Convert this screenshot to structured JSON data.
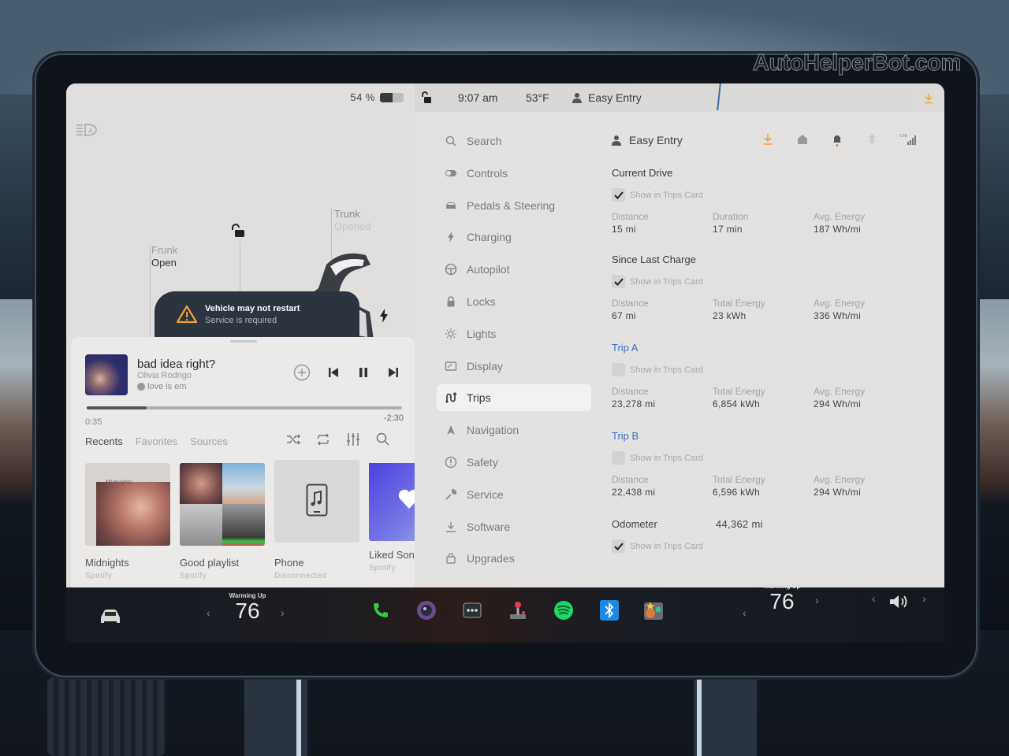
{
  "watermark": "AutoHelperBot.com",
  "status": {
    "battery_percent": "54 %",
    "battery_level": 0.54,
    "time": "9:07 am",
    "temperature": "53°F",
    "driver_profile": "Easy Entry"
  },
  "vehicle": {
    "frunk_label": "Frunk",
    "frunk_state": "Open",
    "trunk_label": "Trunk",
    "trunk_state": "Opened",
    "alert_title": "Vehicle may not restart",
    "alert_subtitle": "Service is required"
  },
  "media": {
    "track_title": "bad idea right?",
    "artist": "Olivia Rodrigo",
    "source": "love is em",
    "elapsed": "0:35",
    "remaining": "-2:30",
    "progress": 0.19,
    "tabs": [
      {
        "label": "Recents",
        "active": true
      },
      {
        "label": "Favorites",
        "active": false
      },
      {
        "label": "Sources",
        "active": false
      }
    ],
    "tiles": [
      {
        "name": "Midnights",
        "subtitle": "Spotify",
        "art_label": "Midnights"
      },
      {
        "name": "Good playlist",
        "subtitle": "Spotify"
      },
      {
        "name": "Phone",
        "subtitle": "Disconnected"
      },
      {
        "name": "Liked Songs",
        "subtitle": "Spotify"
      }
    ]
  },
  "menu": {
    "items": [
      {
        "label": "Search",
        "icon": "search-icon",
        "active": false
      },
      {
        "label": "Controls",
        "icon": "toggle-icon",
        "active": false
      },
      {
        "label": "Pedals & Steering",
        "icon": "car-front-icon",
        "active": false
      },
      {
        "label": "Charging",
        "icon": "bolt-icon",
        "active": false
      },
      {
        "label": "Autopilot",
        "icon": "steering-wheel-icon",
        "active": false
      },
      {
        "label": "Locks",
        "icon": "lock-icon",
        "active": false
      },
      {
        "label": "Lights",
        "icon": "sun-icon",
        "active": false
      },
      {
        "label": "Display",
        "icon": "display-icon",
        "active": false
      },
      {
        "label": "Trips",
        "icon": "route-icon",
        "active": true
      },
      {
        "label": "Navigation",
        "icon": "navigation-arrow-icon",
        "active": false
      },
      {
        "label": "Safety",
        "icon": "alert-circle-icon",
        "active": false
      },
      {
        "label": "Service",
        "icon": "wrench-icon",
        "active": false
      },
      {
        "label": "Software",
        "icon": "download-icon",
        "active": false
      },
      {
        "label": "Upgrades",
        "icon": "shopping-bag-icon",
        "active": false
      }
    ]
  },
  "trips": {
    "profile": "Easy Entry",
    "show_in_trips_label": "Show in Trips Card",
    "current_drive": {
      "title": "Current Drive",
      "show": true,
      "stats": [
        {
          "label": "Distance",
          "value": "15 mi"
        },
        {
          "label": "Duration",
          "value": "17 min"
        },
        {
          "label": "Avg. Energy",
          "value": "187 Wh/mi"
        }
      ]
    },
    "since_last_charge": {
      "title": "Since Last Charge",
      "show": true,
      "stats": [
        {
          "label": "Distance",
          "value": "67 mi"
        },
        {
          "label": "Total Energy",
          "value": "23 kWh"
        },
        {
          "label": "Avg. Energy",
          "value": "336 Wh/mi"
        }
      ]
    },
    "trip_a": {
      "title": "Trip A",
      "show": false,
      "stats": [
        {
          "label": "Distance",
          "value": "23,278 mi"
        },
        {
          "label": "Total Energy",
          "value": "6,854 kWh"
        },
        {
          "label": "Avg. Energy",
          "value": "294 Wh/mi"
        }
      ]
    },
    "trip_b": {
      "title": "Trip B",
      "show": false,
      "stats": [
        {
          "label": "Distance",
          "value": "22,438 mi"
        },
        {
          "label": "Total Energy",
          "value": "6,596 kWh"
        },
        {
          "label": "Avg. Energy",
          "value": "294 Wh/mi"
        }
      ]
    },
    "odometer": {
      "label": "Odometer",
      "value": "44,362 mi",
      "show": true
    }
  },
  "dock": {
    "driver_climate": {
      "status": "Warming Up",
      "temp": "76"
    },
    "passenger_climate": {
      "status": "Warming Up",
      "temp": "76"
    },
    "apps": [
      "phone-icon",
      "camera-icon",
      "more-icon",
      "arcade-icon",
      "spotify-icon",
      "bluetooth-icon",
      "toybox-icon"
    ]
  },
  "colors": {
    "link_blue": "#3d6cc0",
    "warning_orange": "#f0a23a",
    "spotify_green": "#1ed760",
    "bluetooth_blue": "#1e88e5",
    "phone_green": "#2ecc40"
  }
}
